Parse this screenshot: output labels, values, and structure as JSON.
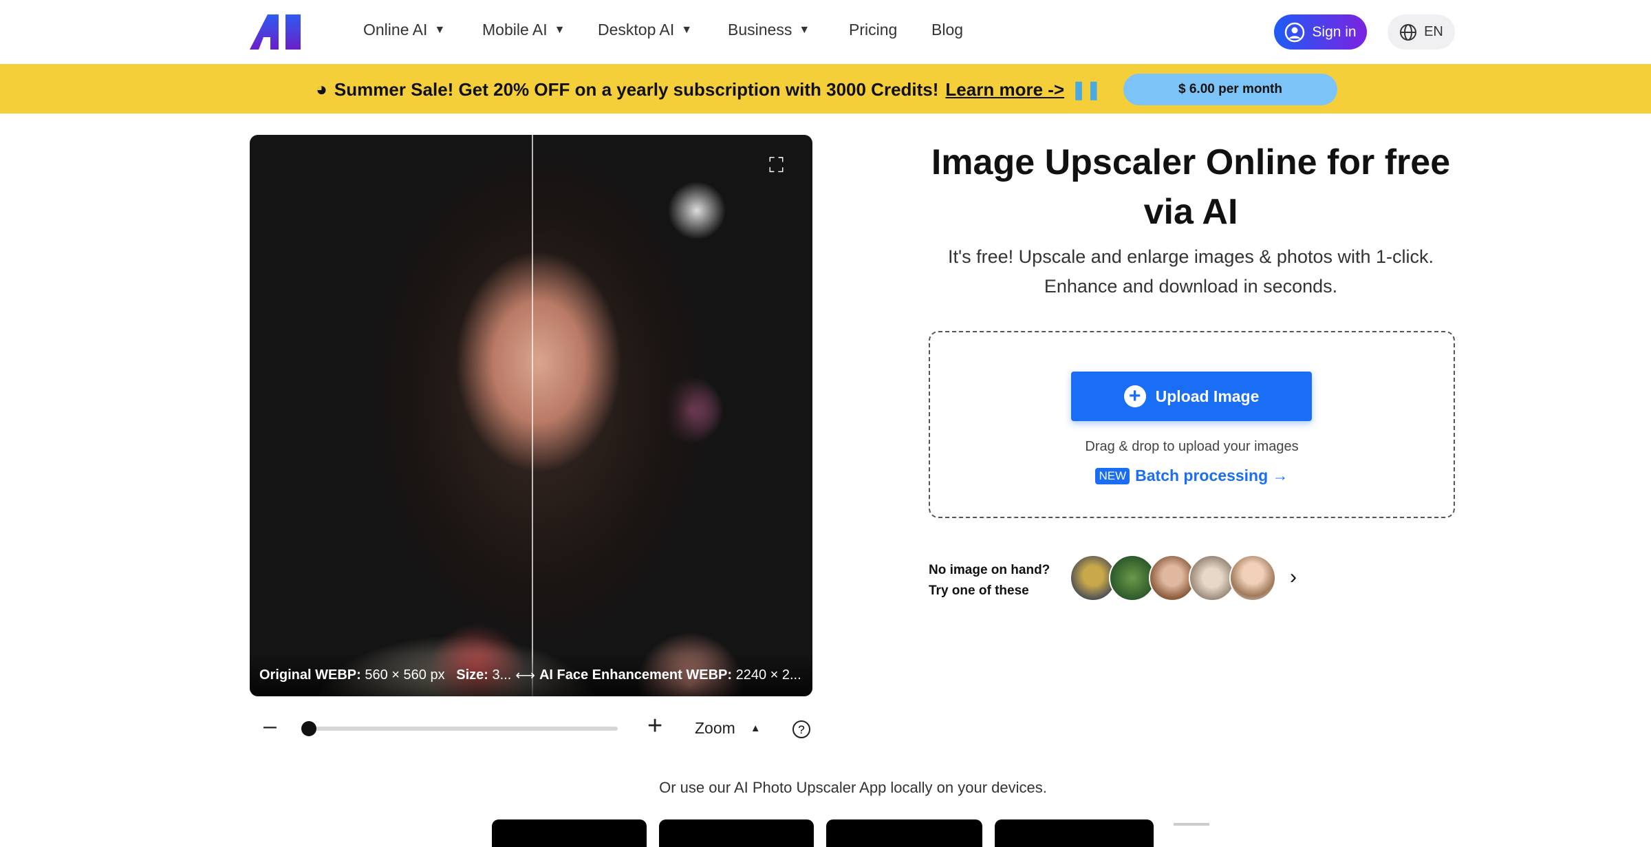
{
  "header": {
    "logo_text": "AI",
    "nav": [
      {
        "label": "Online AI",
        "dropdown": true
      },
      {
        "label": "Mobile AI",
        "dropdown": true
      },
      {
        "label": "Desktop AI",
        "dropdown": true
      },
      {
        "label": "Business",
        "dropdown": true
      },
      {
        "label": "Pricing",
        "dropdown": false
      },
      {
        "label": "Blog",
        "dropdown": false
      }
    ],
    "sign_in": "Sign in",
    "language": "EN"
  },
  "banner": {
    "text": "Summer Sale! Get 20% OFF on a yearly subscription with 3000 Credits!",
    "link": "Learn more ->",
    "price_button": "$ 6.00 per month",
    "color": "#f5cf3a"
  },
  "viewer": {
    "left_label": "Original WEBP:",
    "left_value": "560 × 560 px",
    "size_label": "Size:",
    "size_value": "3...",
    "right_label": "AI Face Enhancement WEBP:",
    "right_value": "2240 × 2...",
    "zoom_label": "Zoom",
    "zoom_level": 0
  },
  "hero": {
    "title": "Image Upscaler Online for free via AI",
    "subtitle_line1": "It's free! Upscale and enlarge images & photos with 1-click.",
    "subtitle_line2": "Enhance and download in seconds."
  },
  "upload": {
    "button": "Upload Image",
    "hint": "Drag & drop to upload your images",
    "new_badge": "NEW",
    "batch": "Batch processing →",
    "accent": "#1a6ef5"
  },
  "samples": {
    "line1": "No image on hand?",
    "line2": "Try one of these",
    "thumbnails": [
      "car",
      "landscape",
      "woman-portrait",
      "family",
      "smiling-woman"
    ]
  },
  "footer": {
    "app_text": "Or use our AI Photo Upscaler App locally on your devices."
  }
}
